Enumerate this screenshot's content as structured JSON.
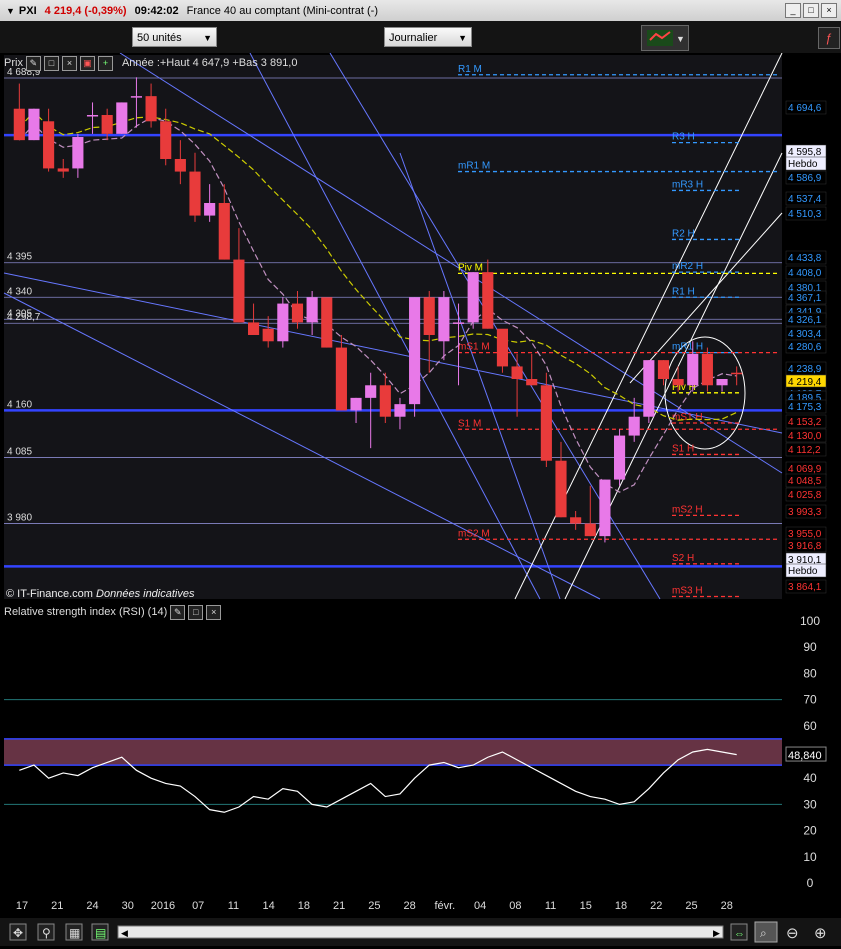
{
  "titlebar": {
    "symbol": "PXI",
    "price_change": "4 219,4 (-0,39%)",
    "time": "09:42:02",
    "instrument": "France 40 au comptant (Mini-contrat  (-)"
  },
  "toolbar": {
    "units": "50 unités",
    "period": "Journalier"
  },
  "price_panel": {
    "label": "Prix",
    "info": "Année :+Haut 4 647,9 +Bas 3 891,0",
    "copyright": "© IT-Finance.com",
    "disclaimer": "Données indicatives"
  },
  "rsi_panel": {
    "label": "Relative strength index (RSI) (14)",
    "value": "48,840"
  },
  "x_labels": [
    "17",
    "21",
    "24",
    "30",
    "2016",
    "07",
    "11",
    "14",
    "18",
    "21",
    "25",
    "28",
    "févr.",
    "04",
    "08",
    "11",
    "15",
    "18",
    "22",
    "25",
    "28"
  ],
  "left_levels": [
    "4 688,9",
    "4 395",
    "4 340",
    "4 305",
    "4 298,7",
    "4 160",
    "4 085",
    "3 980"
  ],
  "pivot_labels": {
    "R1 M": "R1 M",
    "R3 H": "R3 H",
    "mR1 M": "mR1 M",
    "mR3 H": "mR3 H",
    "R2 H": "R2 H",
    "mR2 H": "mR2 H",
    "Piv M": "Piv M",
    "R1 H": "R1 H",
    "mR1 H": "mR1 H",
    "mS1 M": "mS1 M",
    "Piv H": "Piv H",
    "S1 M": "S1 M",
    "mS1 H": "mS1 H",
    "S1 H": "S1 H",
    "mS2 H": "mS2 H",
    "mS2 M": "mS2 M",
    "S2 H": "S2 H",
    "mS3 H": "mS3 H"
  },
  "right_prices": [
    "4 694,6",
    "4 595,8",
    "Hebdo",
    "4 586,9",
    "4 537,4",
    "4 510,3",
    "4 433,8",
    "4 408,0",
    "4 380,1",
    "4 367,1",
    "4 341,9",
    "4 326,1",
    "4 303,4",
    "4 280,6",
    "4 238,9",
    "4 219,4",
    "4 198,7",
    "4 189,5",
    "4 175,3",
    "4 153,2",
    "4 130,0",
    "4 112,2",
    "4 069,9",
    "4 048,5",
    "4 025,8",
    "3 993,3",
    "3 955,0",
    "3 916,8",
    "3 910,1",
    "Hebdo",
    "3 864,1"
  ],
  "rsi_ticks": [
    "100",
    "90",
    "80",
    "70",
    "60",
    "50",
    "40",
    "30",
    "20",
    "10",
    "0"
  ],
  "colors": {
    "bull": "#e879e8",
    "bear": "#e83b3b",
    "blue_line": "#5566ff",
    "yellow": "#ffff00",
    "accent_price": "#ffd700"
  },
  "chart_data": {
    "type": "candlestick",
    "x_labels": [
      "17",
      "21",
      "24",
      "30",
      "2016",
      "07",
      "11",
      "14",
      "18",
      "21",
      "25",
      "28",
      "févr.",
      "04",
      "08",
      "11",
      "15",
      "18",
      "22",
      "25",
      "28"
    ],
    "ohlc": [
      [
        4640,
        4680,
        4590,
        4590
      ],
      [
        4590,
        4640,
        4590,
        4640
      ],
      [
        4620,
        4640,
        4540,
        4545
      ],
      [
        4545,
        4560,
        4530,
        4540
      ],
      [
        4545,
        4600,
        4530,
        4595
      ],
      [
        4630,
        4650,
        4600,
        4630
      ],
      [
        4630,
        4640,
        4590,
        4600
      ],
      [
        4600,
        4650,
        4600,
        4650
      ],
      [
        4660,
        4690,
        4610,
        4660
      ],
      [
        4660,
        4680,
        4610,
        4620
      ],
      [
        4620,
        4640,
        4550,
        4560
      ],
      [
        4560,
        4590,
        4520,
        4540
      ],
      [
        4540,
        4570,
        4460,
        4470
      ],
      [
        4470,
        4520,
        4460,
        4490
      ],
      [
        4490,
        4520,
        4400,
        4400
      ],
      [
        4400,
        4450,
        4300,
        4300
      ],
      [
        4300,
        4330,
        4280,
        4280
      ],
      [
        4290,
        4310,
        4260,
        4270
      ],
      [
        4270,
        4340,
        4260,
        4330
      ],
      [
        4330,
        4350,
        4290,
        4300
      ],
      [
        4300,
        4350,
        4280,
        4340
      ],
      [
        4340,
        4330,
        4260,
        4260
      ],
      [
        4260,
        4280,
        4160,
        4160
      ],
      [
        4160,
        4180,
        4140,
        4180
      ],
      [
        4180,
        4220,
        4100,
        4200
      ],
      [
        4200,
        4220,
        4140,
        4150
      ],
      [
        4150,
        4180,
        4130,
        4170
      ],
      [
        4170,
        4340,
        4150,
        4340
      ],
      [
        4340,
        4350,
        4220,
        4280
      ],
      [
        4270,
        4350,
        4240,
        4340
      ],
      [
        4300,
        4330,
        4200,
        4300
      ],
      [
        4300,
        4380,
        4290,
        4380
      ],
      [
        4380,
        4400,
        4290,
        4290
      ],
      [
        4290,
        4240,
        4220,
        4230
      ],
      [
        4230,
        4250,
        4150,
        4210
      ],
      [
        4210,
        4250,
        4200,
        4200
      ],
      [
        4200,
        4220,
        4070,
        4080
      ],
      [
        4080,
        4110,
        3990,
        3990
      ],
      [
        3990,
        4000,
        3970,
        3980
      ],
      [
        3980,
        4040,
        3960,
        3960
      ],
      [
        3960,
        4050,
        3950,
        4050
      ],
      [
        4050,
        4130,
        4040,
        4120
      ],
      [
        4120,
        4180,
        4110,
        4150
      ],
      [
        4150,
        4240,
        4140,
        4240
      ],
      [
        4240,
        4240,
        4200,
        4210
      ],
      [
        4210,
        4230,
        4190,
        4200
      ],
      [
        4200,
        4270,
        4190,
        4250
      ],
      [
        4250,
        4260,
        4190,
        4200
      ],
      [
        4200,
        4210,
        4190,
        4210
      ],
      [
        4220,
        4230,
        4200,
        4219
      ]
    ],
    "rsi": [
      43,
      45,
      40,
      42,
      41,
      44,
      46,
      48,
      43,
      40,
      38,
      37,
      33,
      28,
      27,
      29,
      33,
      32,
      36,
      35,
      30,
      29,
      32,
      35,
      38,
      33,
      34,
      40,
      45,
      46,
      44,
      45,
      48,
      50,
      47,
      44,
      41,
      38,
      35,
      33,
      32,
      30,
      31,
      36,
      42,
      47,
      50,
      51,
      50,
      49
    ],
    "ylabel": "",
    "ylim": [
      3860,
      4700
    ]
  }
}
